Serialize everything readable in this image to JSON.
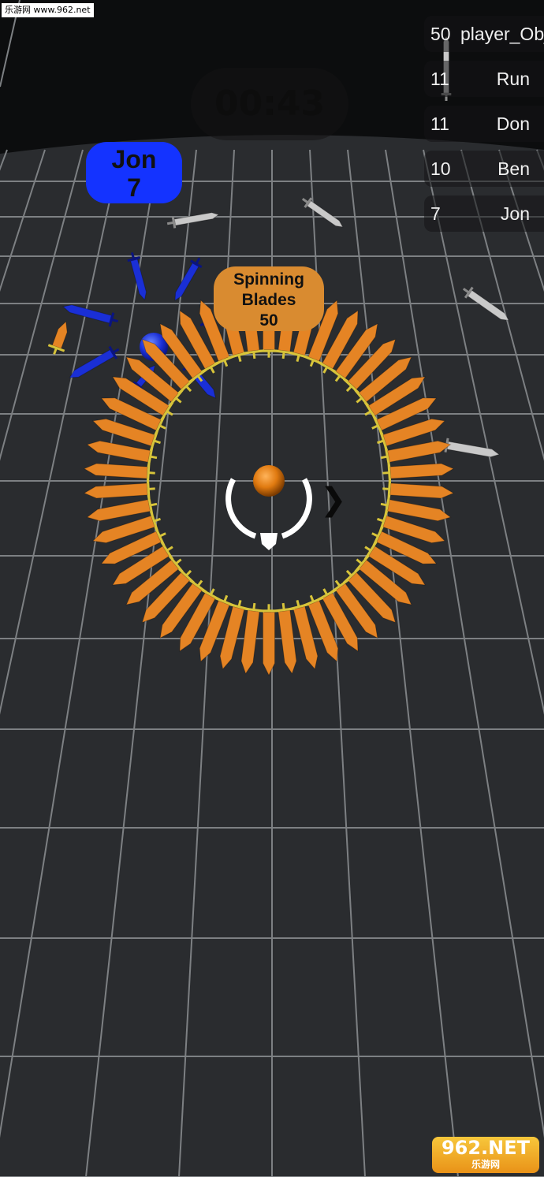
{
  "watermark": {
    "text": "乐游网 www.962.net"
  },
  "timer": {
    "text": "00:43"
  },
  "leaderboard": [
    {
      "score": "50",
      "name": "player_Objec"
    },
    {
      "score": "11",
      "name": "Run"
    },
    {
      "score": "11",
      "name": "Don"
    },
    {
      "score": "10",
      "name": "Ben"
    },
    {
      "score": "7",
      "name": "Jon"
    }
  ],
  "enemy_tag": {
    "name": "Jon",
    "score": "7",
    "color": "#1433ff"
  },
  "player_tag": {
    "line1": "Spinning",
    "line2": "Blades",
    "score": "50",
    "color": "#d98b30"
  },
  "player": {
    "blade_count": 50,
    "ball_color": "#e07a10",
    "blade_color": "#e58424"
  },
  "logo": {
    "text": "962.NET",
    "subtext": "乐游网"
  },
  "colors": {
    "floor": "#2a2c2f",
    "grid": "#8a8d90",
    "sky": "#0c0d0e",
    "enemy": "#1a2fd6"
  }
}
